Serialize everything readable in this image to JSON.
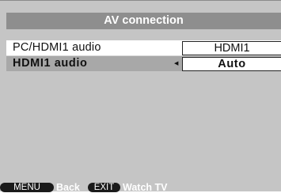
{
  "menu": {
    "title": "AV connection",
    "rows": [
      {
        "label": "PC/HDMI1 audio",
        "value": "HDMI1",
        "selected": false
      },
      {
        "label": "HDMI1 audio",
        "value": "Auto",
        "selected": true
      }
    ]
  },
  "footer": {
    "menu_key": "MENU",
    "menu_action": "Back",
    "exit_key": "EXIT",
    "exit_action": "Watch TV"
  },
  "colors": {
    "panel": "#c5c5c5",
    "title_bar": "#8e8e8e",
    "selected_row": "#a8a8a8",
    "key_badge": "#1a1a1a"
  },
  "icons": {
    "left_arrow": "triangle-left-icon",
    "right_arrow": "triangle-right-icon"
  }
}
